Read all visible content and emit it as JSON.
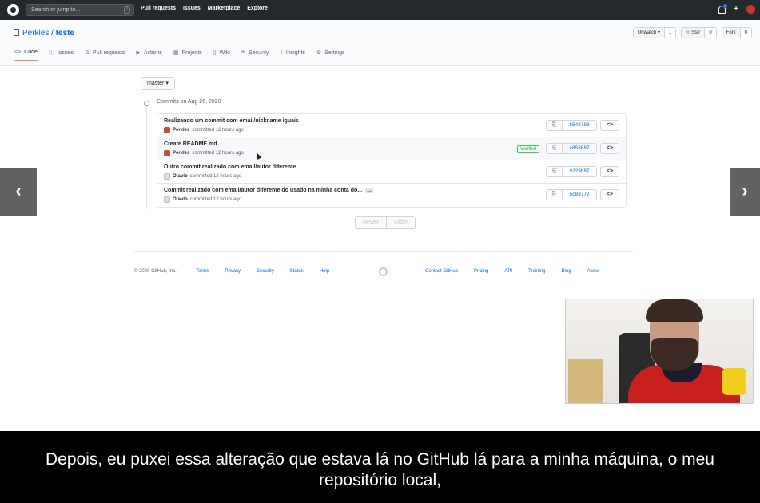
{
  "header": {
    "search_placeholder": "Search or jump to...",
    "search_shortcut": "/",
    "nav": [
      "Pull requests",
      "Issues",
      "Marketplace",
      "Explore"
    ],
    "plus": "+"
  },
  "repo": {
    "owner": "Perkles",
    "separator": " / ",
    "name": "teste",
    "actions": [
      {
        "label": "Unwatch ▾",
        "count": "1"
      },
      {
        "label": "☆ Star",
        "count": "0"
      },
      {
        "label": "Fork",
        "count": "0"
      }
    ],
    "tabs": [
      {
        "icon": "<>",
        "label": "Code"
      },
      {
        "icon": "ⓘ",
        "label": "Issues"
      },
      {
        "icon": "⇅",
        "label": "Pull requests"
      },
      {
        "icon": "▶",
        "label": "Actions"
      },
      {
        "icon": "▦",
        "label": "Projects"
      },
      {
        "icon": "▯",
        "label": "Wiki"
      },
      {
        "icon": "⛨",
        "label": "Security"
      },
      {
        "icon": "⌇",
        "label": "Insights"
      },
      {
        "icon": "⚙",
        "label": "Settings"
      }
    ]
  },
  "branch": "master ▾",
  "commits_date": "Commits on Aug 26, 2020",
  "commits": [
    {
      "message": "Realizando um commit com email/nickname iguais",
      "author": "Perkles",
      "time": "committed 12 hours ago",
      "sha": "8548798",
      "verified": "",
      "ellipsis": ""
    },
    {
      "message": "Create README.md",
      "author": "Perkles",
      "time": "committed 12 hours ago",
      "sha": "a858887",
      "verified": "Verified",
      "ellipsis": ""
    },
    {
      "message": "Outro commit realizado com email/autor diferente",
      "author": "Otavio",
      "time": "committed 12 hours ago",
      "sha": "9229b87",
      "verified": "",
      "ellipsis": ""
    },
    {
      "message": "Commit realizado com email/autor diferente do usado na minha conta do...",
      "author": "Otavio",
      "time": "committed 12 hours ago",
      "sha": "5c8d772",
      "verified": "",
      "ellipsis": "…"
    }
  ],
  "pager": {
    "newer": "Newer",
    "older": "Older"
  },
  "footer": {
    "copyright": "© 2020 GitHub, Inc.",
    "left_links": [
      "Terms",
      "Privacy",
      "Security",
      "Status",
      "Help"
    ],
    "right_links": [
      "Contact GitHub",
      "Pricing",
      "API",
      "Training",
      "Blog",
      "About"
    ]
  },
  "nav_arrows": {
    "prev": "‹",
    "next": "›"
  },
  "caption": "Depois, eu puxei essa alteração que estava lá no GitHub lá para a minha máquina, o meu repositório local,"
}
